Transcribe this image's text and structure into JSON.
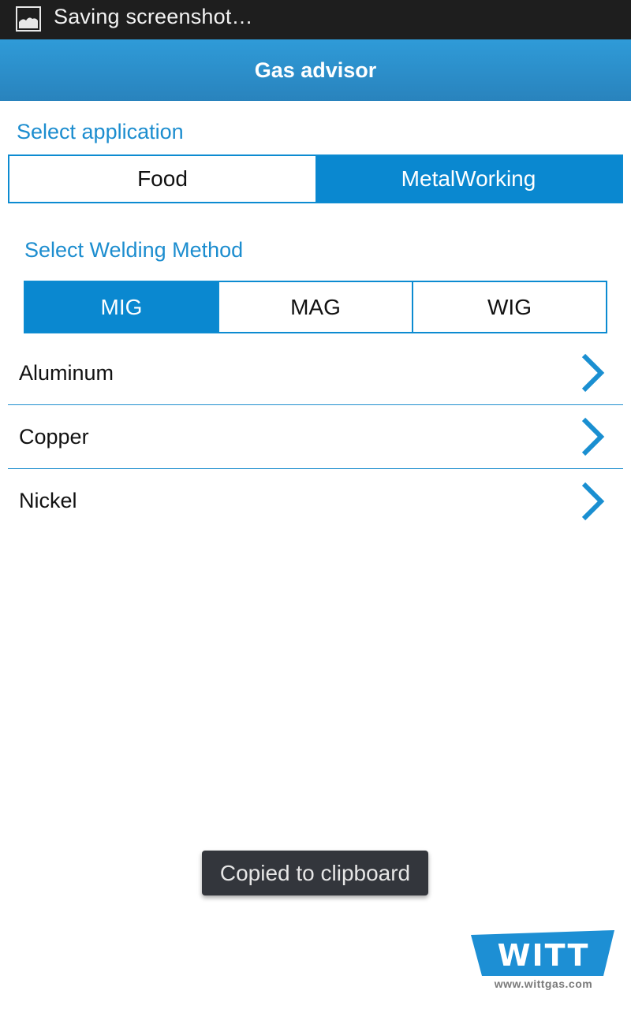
{
  "status_bar": {
    "notification_icon": "image-icon",
    "text": "Saving screenshot…"
  },
  "action_bar": {
    "title": "Gas advisor"
  },
  "application": {
    "label": "Select application",
    "options": [
      {
        "label": "Food",
        "selected": false
      },
      {
        "label": "MetalWorking",
        "selected": true
      }
    ]
  },
  "welding": {
    "label": "Select Welding Method",
    "options": [
      {
        "label": "MIG",
        "selected": true
      },
      {
        "label": "MAG",
        "selected": false
      },
      {
        "label": "WIG",
        "selected": false
      }
    ]
  },
  "materials": [
    {
      "label": "Aluminum",
      "icon": "chevron-right-icon"
    },
    {
      "label": "Copper",
      "icon": "chevron-right-icon"
    },
    {
      "label": "Nickel",
      "icon": "chevron-right-icon"
    }
  ],
  "toast": {
    "text": "Copied to clipboard"
  },
  "logo": {
    "brand": "WITT",
    "url": "www.wittgas.com"
  },
  "colors": {
    "accent": "#0a88d0",
    "action_bar": "#2b8fcb",
    "status_bar": "#1e1e1e",
    "toast": "#33363c"
  }
}
